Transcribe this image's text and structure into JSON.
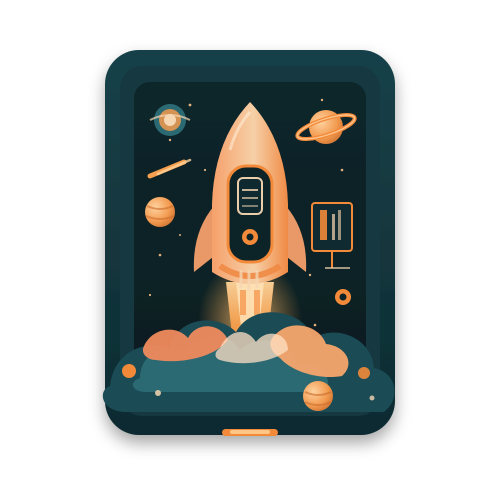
{
  "scene": {
    "background": "#ffffff",
    "frame_outer": "#0f2f36",
    "frame_inner": "#12353d",
    "panel": "#0c2328",
    "accent_orange": "#f28a3a",
    "accent_light": "#f6d7b3",
    "accent_teal": "#2f6e78",
    "cloud_dark": "#1b4b55",
    "cloud_teal": "#2c6a73",
    "cloud_orange": "#f08a5d",
    "cloud_peach": "#f6a56b",
    "screen_glow": "#f29f4b",
    "shadow": "#0a1c20"
  },
  "icons": {
    "rocket": "rocket-icon",
    "planet_ringed": "ringed-planet-icon",
    "planet_small": "small-planet-icon",
    "satellite_orb": "satellite-orb-icon",
    "sign": "signpost-icon",
    "comet": "comet-icon"
  }
}
